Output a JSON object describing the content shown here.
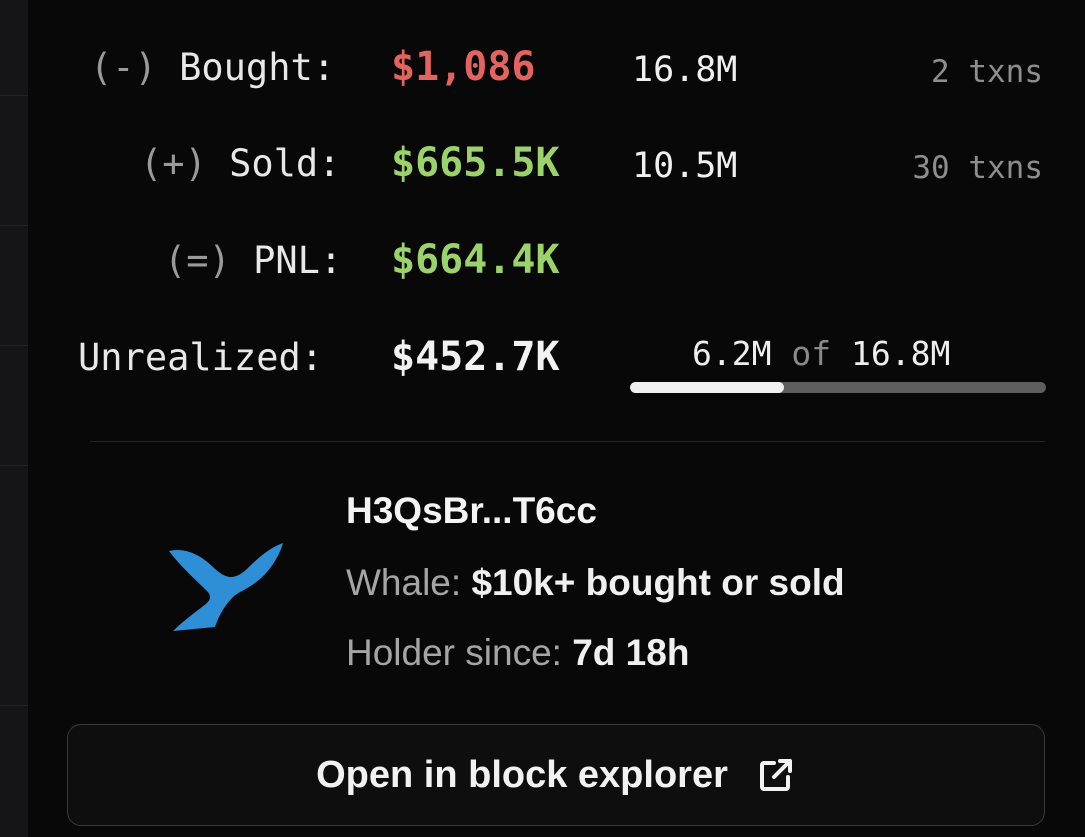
{
  "stats": {
    "bought": {
      "sign": "(-)",
      "label": "Bought:",
      "value": "$1,086",
      "tokens": "16.8M",
      "txns": "2 txns",
      "value_color": "#e5635f"
    },
    "sold": {
      "sign": "(+)",
      "label": "Sold:",
      "value": "$665.5K",
      "tokens": "10.5M",
      "txns": "30 txns",
      "value_color": "#9bd36b"
    },
    "pnl": {
      "sign": "(=)",
      "label": "PNL:",
      "value": "$664.4K",
      "value_color": "#9bd36b"
    },
    "unrealized": {
      "label": "Unrealized:",
      "value": "$452.7K",
      "held": "6.2M",
      "of_word": "of",
      "total": "16.8M",
      "held_fraction": 0.37
    }
  },
  "wallet": {
    "icon": "whale-tail-icon",
    "icon_color": "#2e8fd6",
    "address": "H3QsBr...T6cc",
    "tier_label": "Whale:",
    "tier_value": "$10k+ bought or sold",
    "holder_label": "Holder since:",
    "holder_value": "7d 18h"
  },
  "actions": {
    "explorer_label": "Open in block explorer",
    "explorer_icon": "external-link-icon"
  }
}
